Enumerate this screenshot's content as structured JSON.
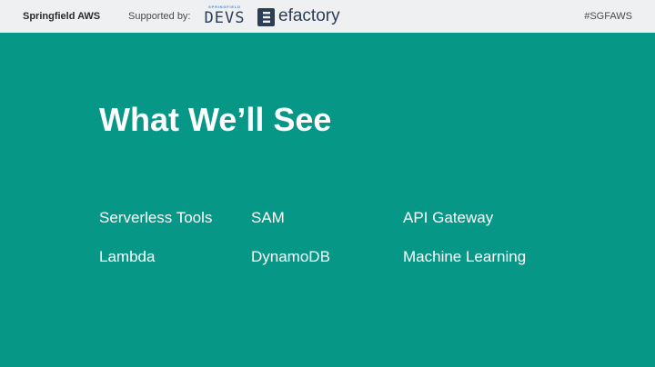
{
  "header": {
    "brand": "Springfield AWS",
    "supported_by": "Supported by:",
    "sponsors": {
      "devs_small": "SPRINGFIELD",
      "devs_big": "DEVS",
      "efactory": "efactory",
      "efactory_icon": "efactory-logo-icon"
    },
    "hashtag": "#SGFAWS"
  },
  "colors": {
    "background": "#079787",
    "header_bg": "#eef0f2",
    "text": "#ffffff",
    "accent_blue": "#4f86c6",
    "dark_navy": "#2c3e56"
  },
  "slide": {
    "title": "What We’ll See",
    "topics": [
      "Serverless Tools",
      "SAM",
      "API Gateway",
      "Lambda",
      "DynamoDB",
      "Machine Learning"
    ]
  }
}
